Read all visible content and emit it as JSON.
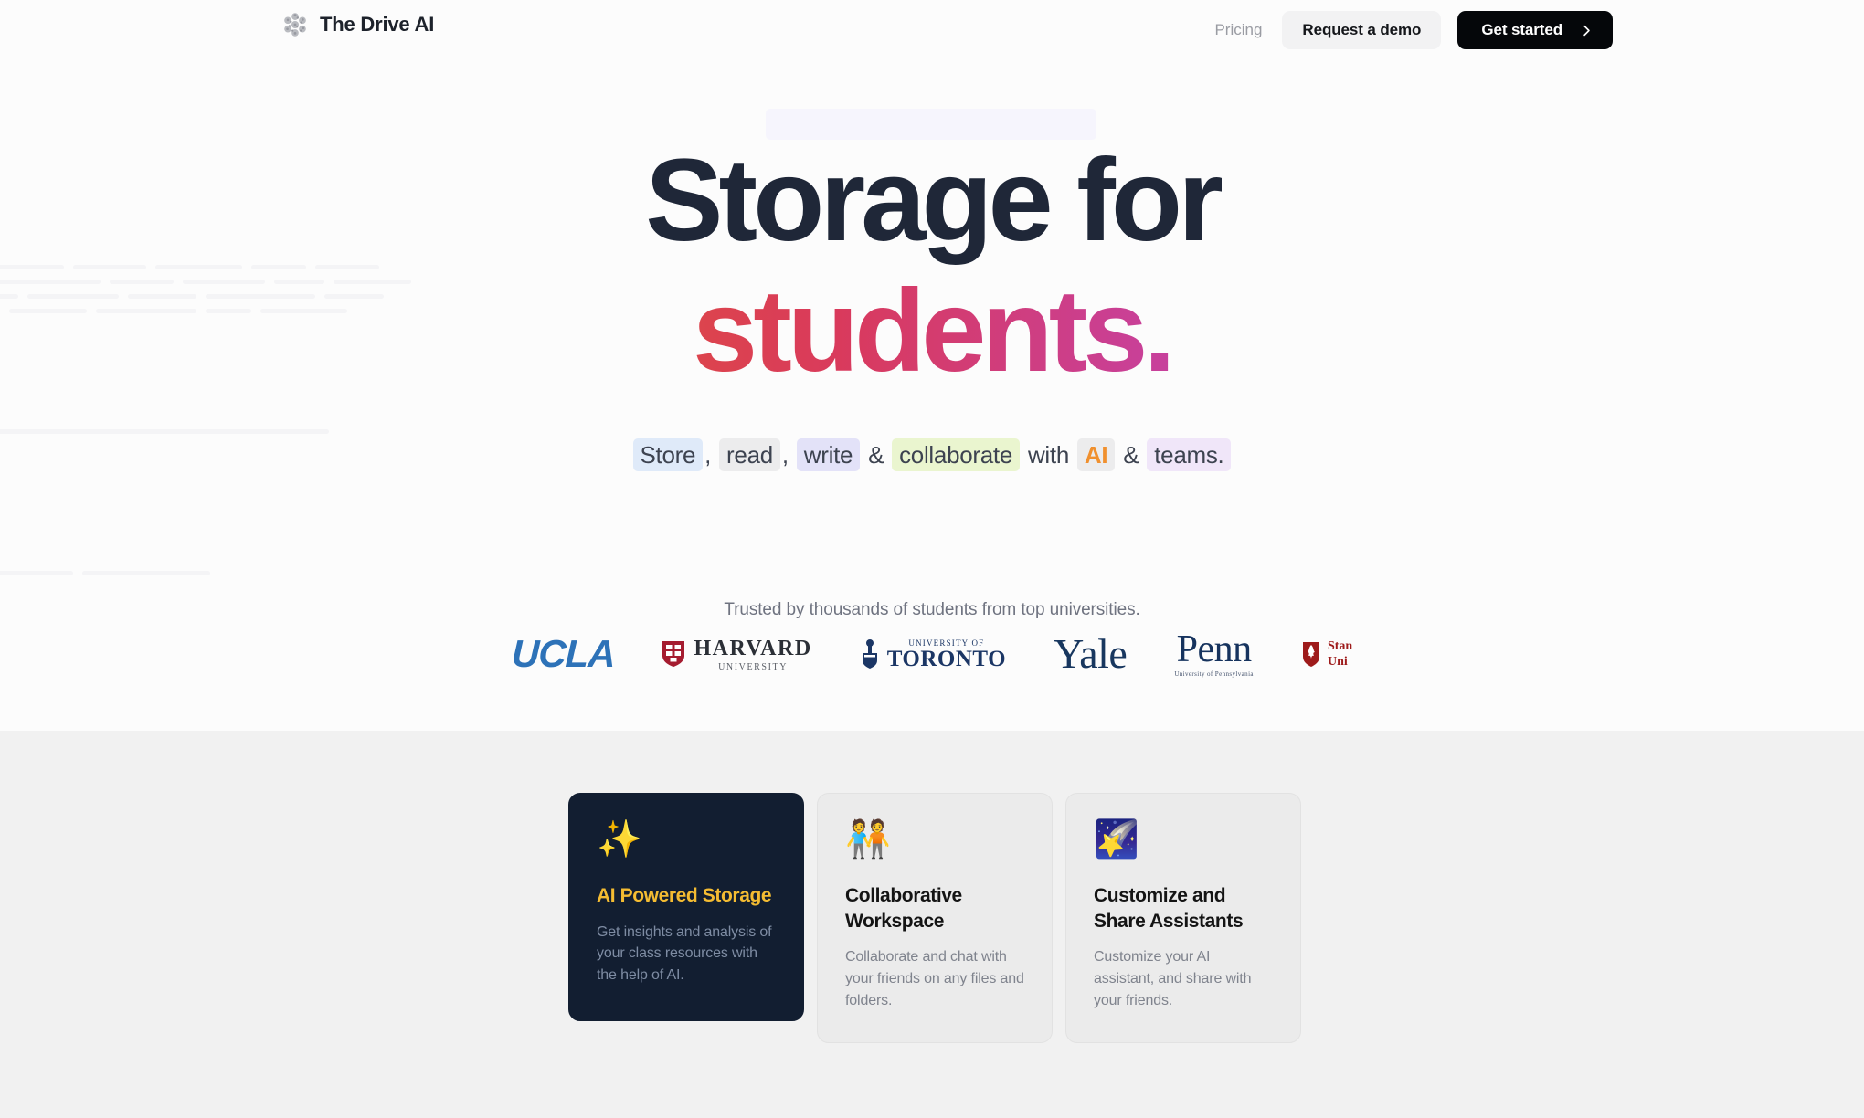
{
  "brand": {
    "name": "The Drive AI",
    "logo_icon": "hexagon-cluster-logo-icon"
  },
  "nav": {
    "pricing_label": "Pricing",
    "demo_label": "Request a demo",
    "get_started_label": "Get started",
    "get_started_icon": "chevron-right-icon"
  },
  "hero": {
    "headline_line1": "Storage for",
    "headline_line2": "students.",
    "subtitle": {
      "store": "Store",
      "comma1": ",",
      "read": "read",
      "comma2": ",",
      "write": "write",
      "amp1": "&",
      "collaborate": "collaborate",
      "with": "with",
      "ai": "AI",
      "amp2": "&",
      "teams": "teams."
    },
    "trusted_text": "Trusted by thousands of students from top universities."
  },
  "universities": [
    {
      "name": "UCLA",
      "text": "UCLA",
      "color": "#2d72b8"
    },
    {
      "name": "Harvard University",
      "line1": "HARVARD",
      "line2": "UNIVERSITY",
      "color": "#a51c30"
    },
    {
      "name": "University of Toronto",
      "line1": "UNIVERSITY OF",
      "line2": "TORONTO",
      "color": "#1b3665"
    },
    {
      "name": "Yale",
      "text": "Yale",
      "color": "#18375f"
    },
    {
      "name": "Penn",
      "text": "Penn",
      "sub": "University of Pennsylvania",
      "color": "#16335e"
    },
    {
      "name": "Stanford University",
      "line1": "Stan",
      "line2": "Uni",
      "color": "#9e1b1b"
    }
  ],
  "features": {
    "cards": [
      {
        "icon": "✨",
        "icon_name": "sparkles-icon",
        "title": "AI Powered Storage",
        "body": "Get insights and analysis of your class resources with the help of AI."
      },
      {
        "icon": "🧑‍🤝‍🧑",
        "icon_name": "people-collaborating-icon",
        "title": "Collaborative Workspace",
        "body": "Collaborate and chat with your friends on any files and folders."
      },
      {
        "icon": "🌠",
        "icon_name": "shooting-star-icon",
        "title": "Customize and Share Assistants",
        "body": "Customize your AI assistant, and share with your friends."
      }
    ]
  },
  "colors": {
    "page_background": "#fcfcfc",
    "features_background": "#f1f1f1",
    "headline_dark": "#1f2738",
    "gradient_start": "#f2882d",
    "gradient_mid": "#d93a5c",
    "gradient_end": "#7a50c8",
    "cta_background": "#05070a",
    "card_dark_background": "#121e31",
    "card_dark_title": "#f4bc32"
  }
}
